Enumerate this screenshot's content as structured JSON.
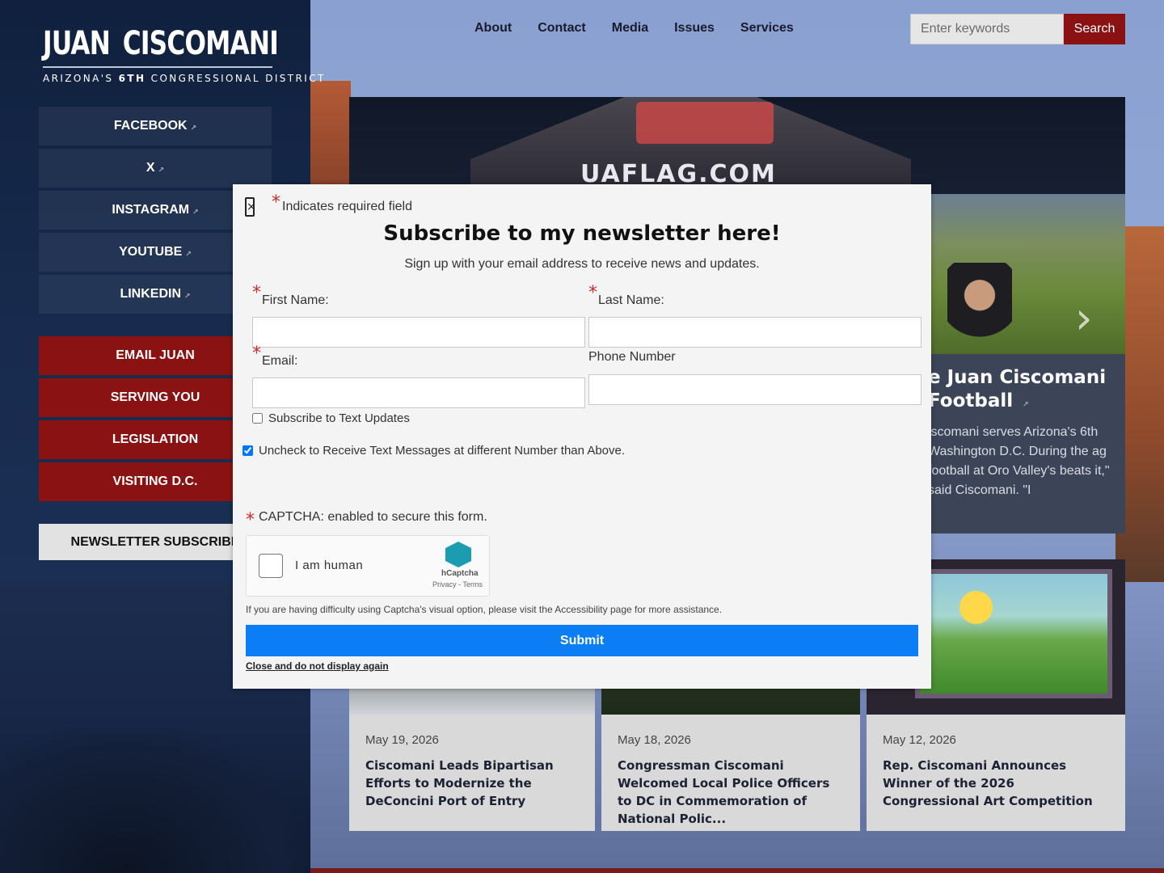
{
  "logo": {
    "name_first": "JUAN",
    "name_last": "CISCOMANI",
    "tagline_pre": "ARIZONA'S ",
    "tagline_bold": "6TH",
    "tagline_post": " CONGRESSIONAL DISTRICT"
  },
  "social": [
    {
      "label": "FACEBOOK",
      "icon": "external-link-icon"
    },
    {
      "label": "X",
      "icon": "external-link-icon"
    },
    {
      "label": "INSTAGRAM",
      "icon": "external-link-icon"
    },
    {
      "label": "YOUTUBE",
      "icon": "external-link-icon"
    },
    {
      "label": "LINKEDIN",
      "icon": "external-link-icon"
    }
  ],
  "sidebar_menu": [
    "EMAIL JUAN",
    "SERVING YOU",
    "LEGISLATION",
    "VISITING D.C."
  ],
  "newsletter_button": "NEWSLETTER SUBSCRIBE",
  "nav": [
    "About",
    "Contact",
    "Media",
    "Issues",
    "Services"
  ],
  "search": {
    "placeholder": "Enter keywords",
    "button": "Search"
  },
  "hero": {
    "tent_text": "UAFLAG.COM",
    "title": "e Juan Ciscomani Football",
    "text": "iscomani serves Arizona's 6th Washington D.C. During the ag football at Oro Valley's beats it,\" said Ciscomani. \"I"
  },
  "news": [
    {
      "date": "May 19, 2026",
      "title": "Ciscomani Leads Bipartisan Efforts to Modernize the DeConcini Port of Entry"
    },
    {
      "date": "May 18, 2026",
      "title": "Congressman Ciscomani Welcomed Local Police Officers to DC in Commemoration of National Polic..."
    },
    {
      "date": "May 12, 2026",
      "title": "Rep. Ciscomani Announces Winner of the 2026 Congressional Art Competition"
    }
  ],
  "modal": {
    "close_glyph": "×",
    "required_note": "Indicates required field",
    "title": "Subscribe to my newsletter here!",
    "subtitle": "Sign up with your email address to receive news and updates.",
    "first_name_label": "First Name:",
    "last_name_label": "Last Name:",
    "email_label": "Email:",
    "phone_label": "Phone Number",
    "text_updates_label": "Subscribe to Text Updates",
    "text_updates_checked": false,
    "different_number_label": "Uncheck to Receive Text Messages at different Number than Above.",
    "different_number_checked": true,
    "captcha_label": "CAPTCHA: enabled to secure this form.",
    "hcaptcha_label": "I am human",
    "hcaptcha_brand": "hCaptcha",
    "hcaptcha_links": "Privacy - Terms",
    "captcha_help": "If you are having difficulty using Captcha's visual option, please visit the Accessibility page for more assistance.",
    "submit": "Submit",
    "close_link": "Close and do not display again"
  },
  "colors": {
    "brand_red": "#8a1212",
    "submit_blue": "#0b7df5",
    "navy": "#172a4c"
  }
}
